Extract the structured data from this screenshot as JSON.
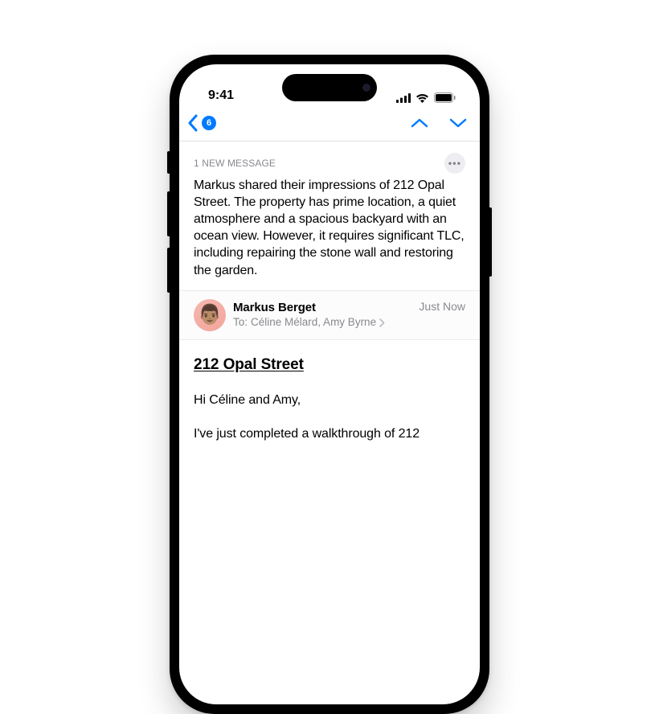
{
  "statusBar": {
    "time": "9:41"
  },
  "nav": {
    "badgeCount": "6"
  },
  "summary": {
    "label": "1 NEW MESSAGE",
    "text": "Markus shared their impressions of 212 Opal Street. The property has prime location, a quiet atmosphere and a spacious backyard with an ocean view. However, it requires significant TLC, including repairing the stone wall and restoring the garden."
  },
  "sender": {
    "avatarEmoji": "👨🏽",
    "name": "Markus Berget",
    "toLabel": "To:",
    "recipients": "Céline Mélard, Amy Byrne",
    "timestamp": "Just Now"
  },
  "email": {
    "subject": "212 Opal Street",
    "greeting": "Hi Céline and Amy,",
    "body1": "I've just completed a walkthrough of 212"
  }
}
